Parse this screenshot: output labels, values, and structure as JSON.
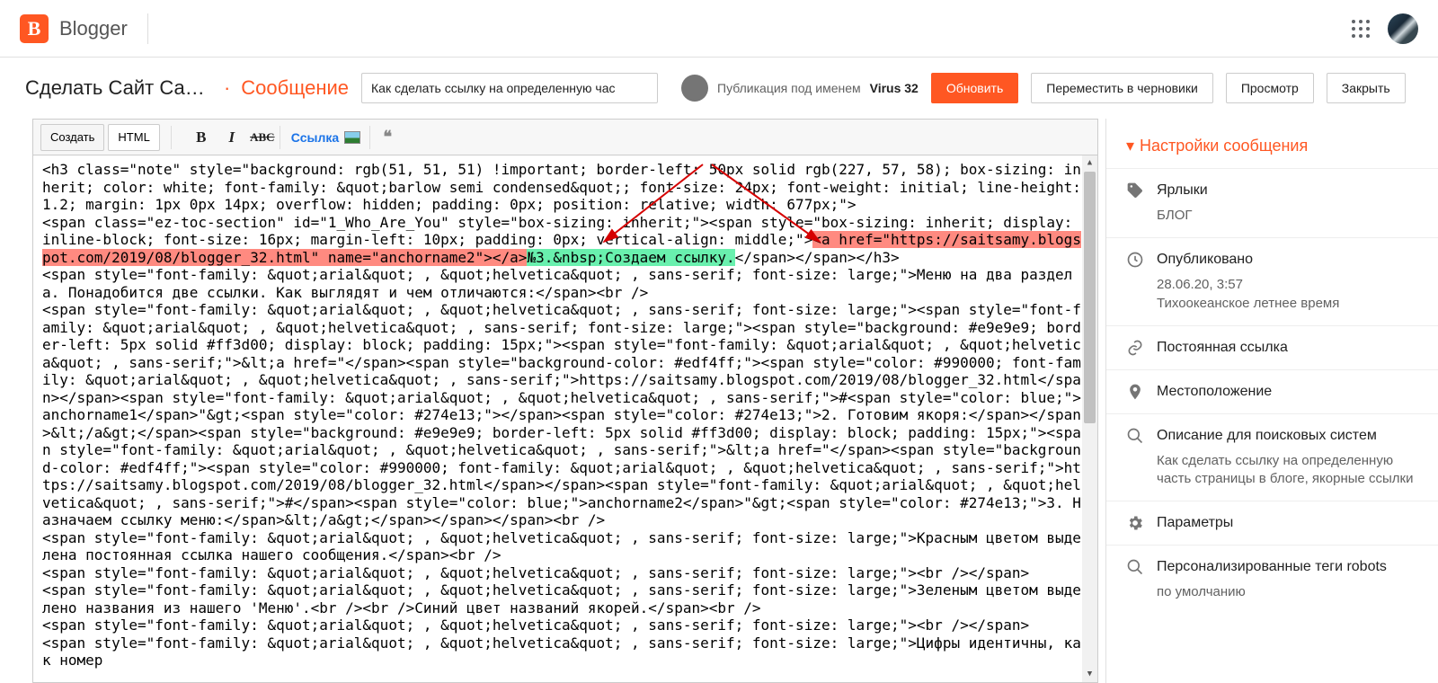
{
  "brand": "Blogger",
  "blog_title": "Сделать Сайт Сам...",
  "page_type": "Сообщение",
  "post_title": "Как сделать ссылку на определенную час",
  "author_prefix": "Публикация под именем",
  "author_name": "Virus 32",
  "buttons": {
    "update": "Обновить",
    "drafts": "Переместить в черновики",
    "preview": "Просмотр",
    "close": "Закрыть"
  },
  "toolbar": {
    "compose": "Создать",
    "html": "HTML",
    "bold": "B",
    "italic": "I",
    "strike": "ABC",
    "link": "Ссылка",
    "quote": "❝"
  },
  "editor": {
    "line1": "<h3 class=\"note\" style=\"background: rgb(51, 51, 51) !important; border-left: 50px solid rgb(227, 57, 58); box-sizing: inherit; color: white; font-family: &quot;barlow semi condensed&quot;; font-size: 24px; font-weight: initial; line-height: 1.2; margin: 1px 0px 14px; overflow: hidden; padding: 0px; position: relative; width: 677px;\">",
    "line2a": "<span class=\"ez-toc-section\" id=\"1_Who_Are_You\" style=\"box-sizing: inherit;\"><span style=\"box-sizing: inherit; display: inline-block; font-size: 16px; margin-left: 10px; padding: 0px; vertical-align: middle;\">",
    "line2b": "<a href=\"https://saitsamy.blogspot.com/2019/08/blogger_32.html\" name=\"anchorname2\"></a>",
    "line2c": "№3.&nbsp;Создаем ссылку.",
    "line2d": "</span></span></h3>",
    "line3": "<span style=\"font-family: &quot;arial&quot; , &quot;helvetica&quot; , sans-serif; font-size: large;\">Меню на два раздела. Понадобится две ссылки. Как выглядят и чем отличаются:</span><br />",
    "line4": "<span style=\"font-family: &quot;arial&quot; , &quot;helvetica&quot; , sans-serif; font-size: large;\"><span style=\"font-family: &quot;arial&quot; , &quot;helvetica&quot; , sans-serif; font-size: large;\"><span style=\"background: #e9e9e9; border-left: 5px solid #ff3d00; display: block; padding: 15px;\"><span style=\"font-family: &quot;arial&quot; , &quot;helvetica&quot; , sans-serif;\">&lt;a href=\"</span><span style=\"background-color: #edf4ff;\"><span style=\"color: #990000; font-family: &quot;arial&quot; , &quot;helvetica&quot; , sans-serif;\">https://saitsamy.blogspot.com/2019/08/blogger_32.html</span></span><span style=\"font-family: &quot;arial&quot; , &quot;helvetica&quot; , sans-serif;\">#<span style=\"color: blue;\">anchorname1</span>\"&gt;<span style=\"color: #274e13;\"></span><span style=\"color: #274e13;\">2. Готовим якоря:</span></span>&lt;/a&gt;</span><span style=\"background: #e9e9e9; border-left: 5px solid #ff3d00; display: block; padding: 15px;\"><span style=\"font-family: &quot;arial&quot; , &quot;helvetica&quot; , sans-serif;\">&lt;a href=\"</span><span style=\"background-color: #edf4ff;\"><span style=\"color: #990000; font-family: &quot;arial&quot; , &quot;helvetica&quot; , sans-serif;\">https://saitsamy.blogspot.com/2019/08/blogger_32.html</span></span><span style=\"font-family: &quot;arial&quot; , &quot;helvetica&quot; , sans-serif;\">#</span><span style=\"color: blue;\">anchorname2</span>\"&gt;<span style=\"color: #274e13;\">3. Назначаем ссылку меню:</span>&lt;/a&gt;</span></span></span><br />",
    "line5": "<span style=\"font-family: &quot;arial&quot; , &quot;helvetica&quot; , sans-serif; font-size: large;\">Красным цветом выделена постоянная ссылка нашего сообщения.</span><br />",
    "line6": "<span style=\"font-family: &quot;arial&quot; , &quot;helvetica&quot; , sans-serif; font-size: large;\"><br /></span>",
    "line7": "<span style=\"font-family: &quot;arial&quot; , &quot;helvetica&quot; , sans-serif; font-size: large;\">Зеленым цветом выделено названия из нашего 'Меню'.<br /><br />Синий цвет названий якорей.</span><br />",
    "line8": "<span style=\"font-family: &quot;arial&quot; , &quot;helvetica&quot; , sans-serif; font-size: large;\"><br /></span>",
    "line9": "<span style=\"font-family: &quot;arial&quot; , &quot;helvetica&quot; , sans-serif; font-size: large;\">Цифры идентичны, как номер"
  },
  "sidebar": {
    "header": "Настройки сообщения",
    "tags": {
      "title": "Ярлыки",
      "value": "БЛОГ"
    },
    "published": {
      "title": "Опубликовано",
      "date": "28.06.20, 3:57",
      "tz": "Тихоокеанское летнее время"
    },
    "permalink": {
      "title": "Постоянная ссылка"
    },
    "location": {
      "title": "Местоположение"
    },
    "search": {
      "title": "Описание для поисковых систем",
      "value": "Как сделать ссылку на определенную часть страницы в блоге, якорные ссылки"
    },
    "params": {
      "title": "Параметры"
    },
    "robots": {
      "title": "Персонализированные теги robots",
      "value": "по умолчанию"
    }
  }
}
